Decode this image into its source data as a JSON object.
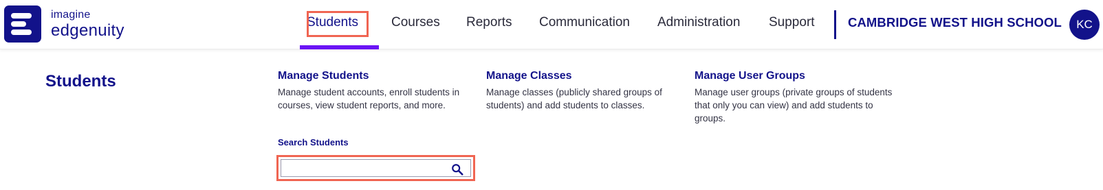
{
  "brand": {
    "line1": "imagine",
    "line2": "edgenuity",
    "color": "#12128a"
  },
  "nav": {
    "items": [
      {
        "label": "Students",
        "active": true
      },
      {
        "label": "Courses"
      },
      {
        "label": "Reports"
      },
      {
        "label": "Communication"
      },
      {
        "label": "Administration"
      },
      {
        "label": "Support"
      }
    ],
    "active_accent": "#6a14f5"
  },
  "school_name": "CAMBRIDGE WEST HIGH SCHOOL",
  "user": {
    "initials": "KC"
  },
  "panel": {
    "title": "Students",
    "cards": [
      {
        "title": "Manage Students",
        "description": "Manage student accounts, enroll students in courses, view student reports, and more."
      },
      {
        "title": "Manage Classes",
        "description": "Manage classes (publicly shared groups of students) and add students to classes."
      },
      {
        "title": "Manage User Groups",
        "description": "Manage user groups (private groups of students that only you can view) and add students to groups."
      }
    ],
    "search": {
      "label": "Search Students",
      "value": "",
      "icon": "search-icon"
    }
  },
  "highlight_color": "#f06552"
}
